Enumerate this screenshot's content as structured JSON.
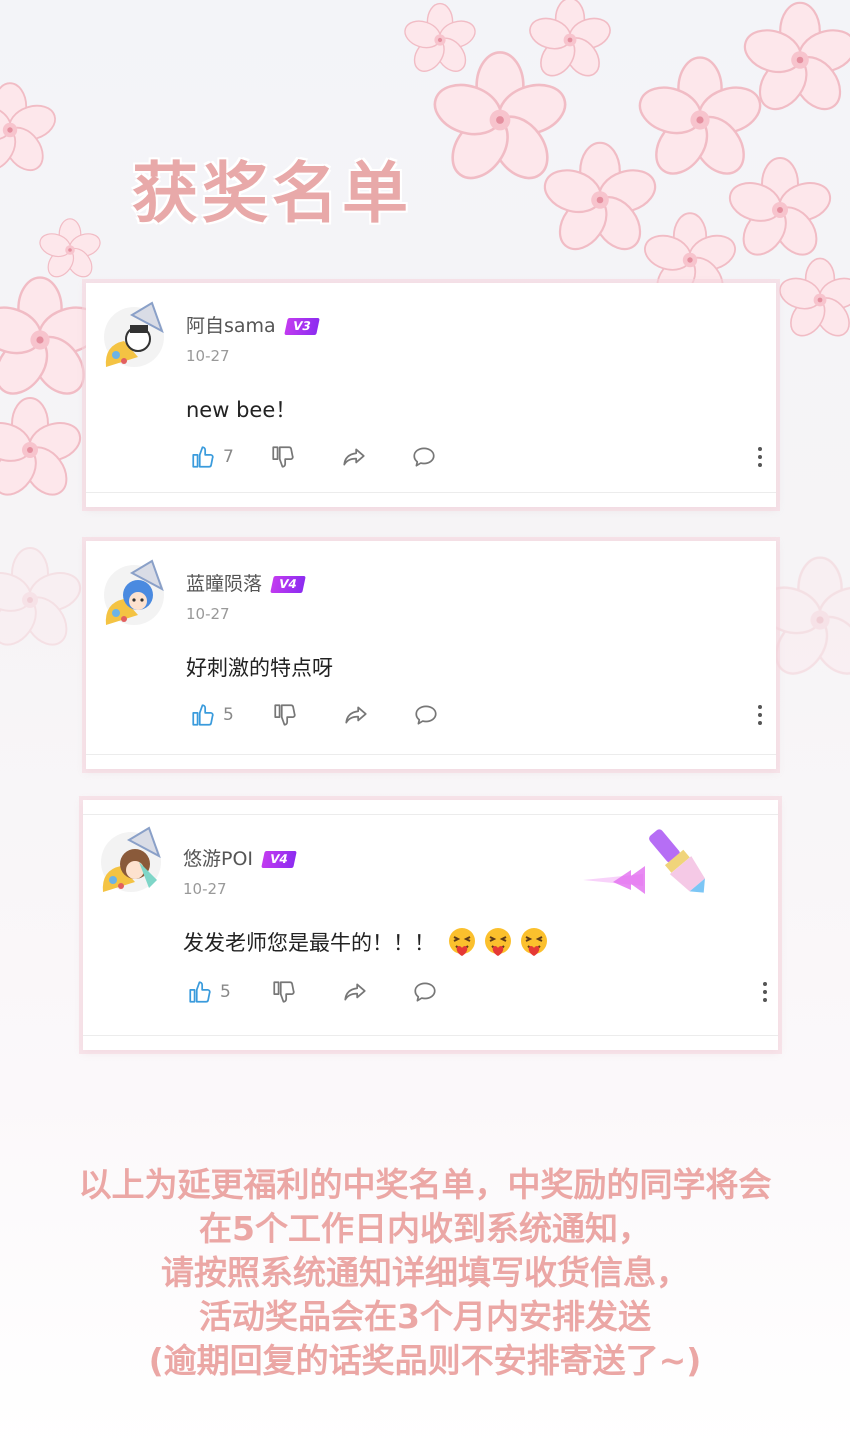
{
  "page": {
    "title": "获奖名单"
  },
  "comments": [
    {
      "username": "阿自sama",
      "level": "V3",
      "date": "10-27",
      "text": "new bee！",
      "likes": "7"
    },
    {
      "username": "蓝瞳陨落",
      "level": "V4",
      "date": "10-27",
      "text": "好刺激的特点呀",
      "likes": "5"
    },
    {
      "username": "悠游POI",
      "level": "V4",
      "date": "10-27",
      "text": "发发老师您是最牛的！！！",
      "likes": "5",
      "emojis": [
        "hug-emoji",
        "hug-emoji",
        "hug-emoji"
      ]
    }
  ],
  "icons": {
    "like": "thumbs-up-icon",
    "dislike": "thumbs-down-icon",
    "share": "share-icon",
    "reply": "reply-bubble-icon",
    "more": "more-vertical-icon"
  },
  "notice": [
    "以上为延更福利的中奖名单，中奖励的同学将会",
    "在5个工作日内收到系统通知，",
    "请按照系统通知详细填写收货信息，",
    "活动奖品会在3个月内安排发送",
    "(逾期回复的话奖品则不安排寄送了~)"
  ],
  "colors": {
    "title": "#e8a9a9",
    "notice": "#eba7a5",
    "like_icon": "#3a9bdc",
    "vip_badge": "#b236f0"
  }
}
